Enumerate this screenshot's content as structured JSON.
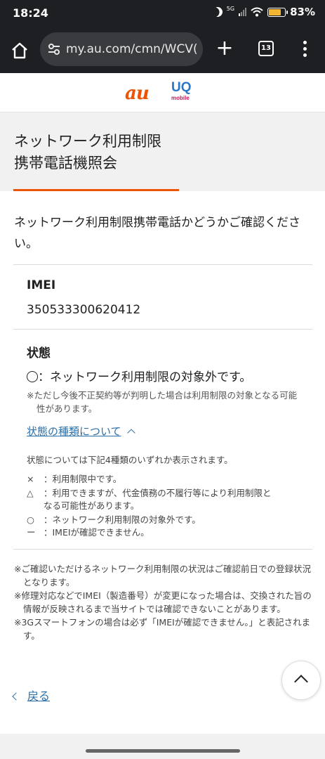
{
  "status_bar": {
    "time": "18:24",
    "signal_label": "5G",
    "battery_percent": "83%",
    "battery_level": 0.83,
    "icons": [
      "moon-icon",
      "signal-icon",
      "wifi-icon",
      "battery-icon"
    ]
  },
  "browser": {
    "url": "my.au.com/cmn/WCV(",
    "tab_count": "13",
    "icons": [
      "home-icon",
      "site-settings-icon",
      "new-tab-icon",
      "tabs-icon",
      "menu-icon"
    ]
  },
  "logos": {
    "au": "au",
    "uq": "UQ",
    "uq_sub": "mobile"
  },
  "page": {
    "title_line1": "ネットワーク利用制限",
    "title_line2": "携帯電話機照会",
    "intro": "ネットワーク利用制限携帯電話かどうかご確認ください。",
    "imei_label": "IMEI",
    "imei_value": "350533300620412",
    "status_label": "状態",
    "status_text": "：ネットワーク利用制限の対象外です。",
    "status_note": "※ただし今後不正契約等が判明した場合は利用制限の対象となる可能性があります。",
    "toggle_link": "状態の種類について",
    "legend_description": "状態については下記4種類のいずれか表示されます。",
    "legend": [
      {
        "symbol": "×",
        "text": "：利用制限中です。"
      },
      {
        "symbol": "△",
        "text": "：利用できますが、代金債務の不履行等により利用制限と",
        "cont": "なる可能性があります。"
      },
      {
        "symbol": "○",
        "text": "：ネットワーク利用制限の対象外です。"
      },
      {
        "symbol": "ー",
        "text": "：IMEIが確認できません。"
      }
    ],
    "footnotes": [
      "※ご確認いただけるネットワーク利用制限の状況はご確認前日での登録状況となります。",
      "※修理対応などでIMEI（製造番号）が変更になった場合は、交換された旨の情報が反映されるまで当サイトでは確認できないことがあります。",
      "※3Gスマートフォンの場合は必ず「IMEIが確認できません。」と表記されます。"
    ],
    "back_link": "戻る"
  },
  "colors": {
    "accent_orange": "#eb5505",
    "link_blue": "#2a6fa8",
    "browser_bar": "#1e1f22"
  }
}
